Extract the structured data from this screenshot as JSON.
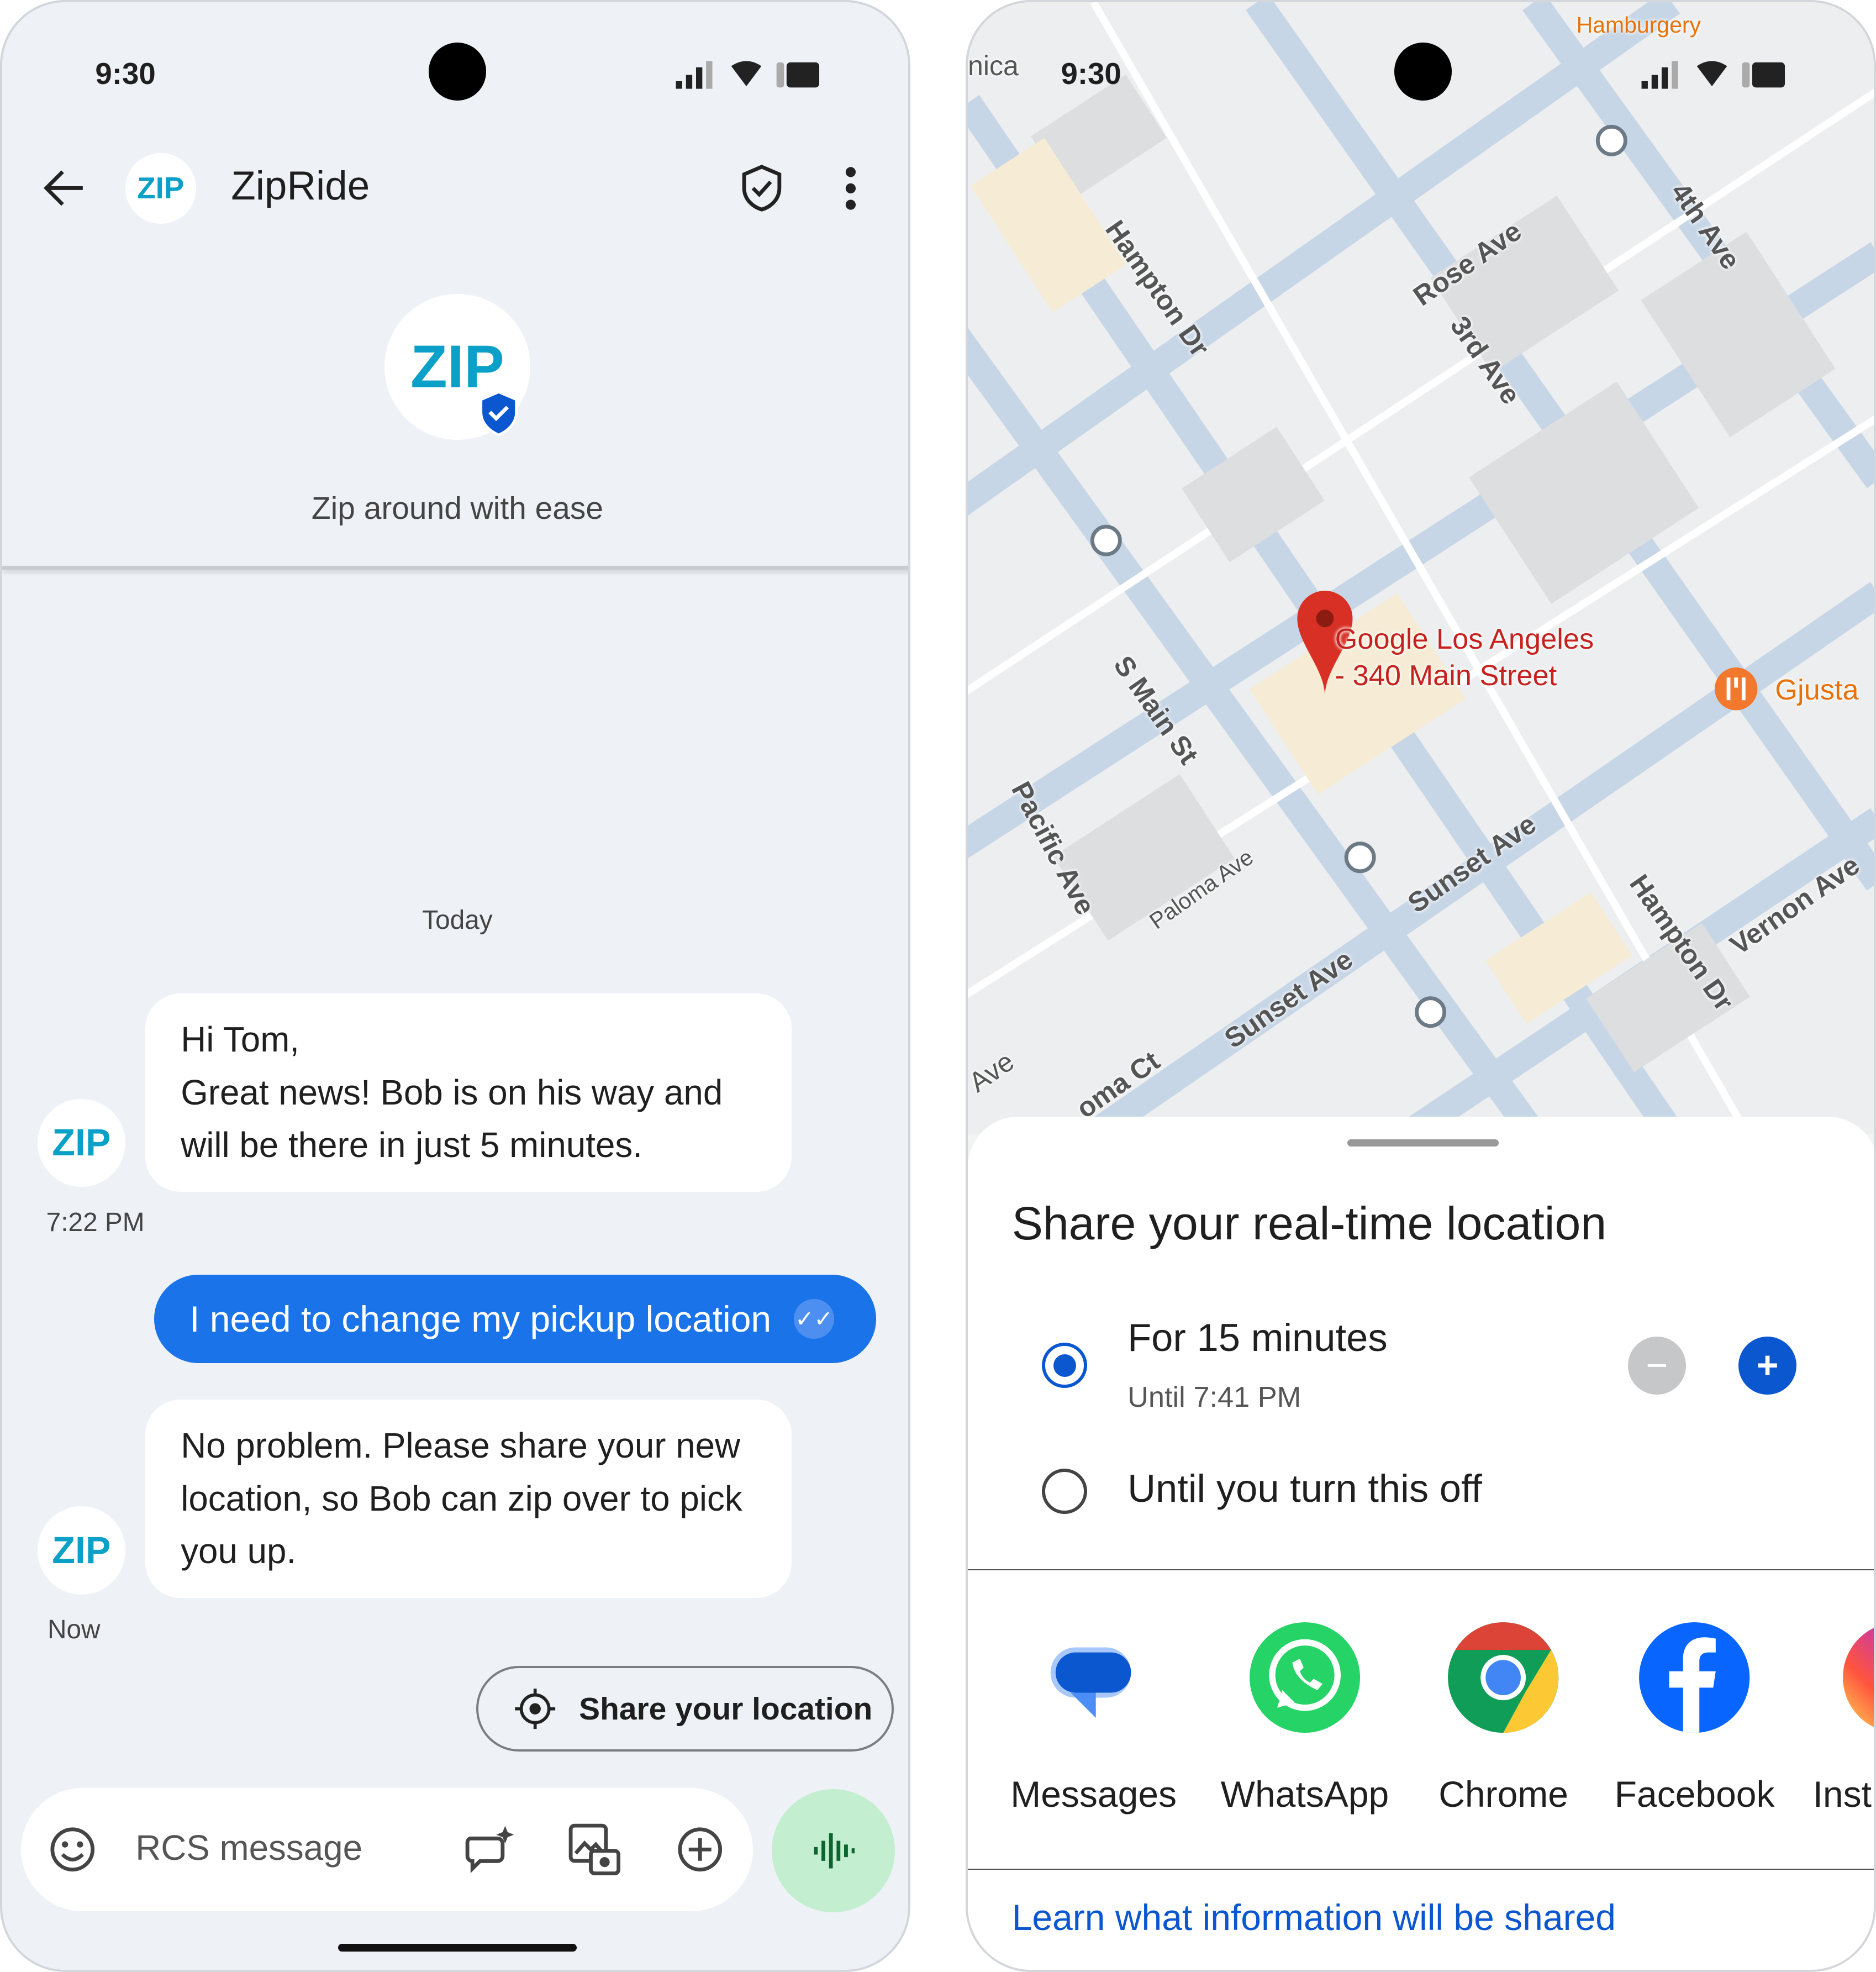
{
  "status": {
    "time": "9:30"
  },
  "chat": {
    "title": "ZipRide",
    "avatar_text": "ZIP",
    "tagline": "Zip around with ease",
    "date_divider": "Today",
    "messages": [
      {
        "from": "ZipRide",
        "text": "Hi Tom,\nGreat news! Bob is on his way and will be there in just 5 minutes.",
        "time": "7:22 PM"
      },
      {
        "from": "me",
        "text": "I need to change my pickup location",
        "status": "read"
      },
      {
        "from": "ZipRide",
        "text": "No problem. Please share your new location, so Bob can zip over to pick you up.",
        "time": "Now"
      }
    ],
    "suggestion": "Share your location",
    "composer_placeholder": "RCS message",
    "accent": "#1a73e8"
  },
  "map": {
    "place": "Google Los Angeles\n- 340 Main Street",
    "poi": "Gjusta",
    "poi_top": "Hamburgery",
    "edge_label": "nica",
    "streets": [
      "Hampton Dr",
      "Rose Ave",
      "3rd Ave",
      "4th Ave",
      "S Main St",
      "Pacific Ave",
      "Paloma Ave",
      "Sunset Ave",
      "Sunset Ave",
      "Hampton Dr",
      "Vernon Ave",
      "oma Ct",
      "Ave"
    ]
  },
  "sheet": {
    "title": "Share your real-time location",
    "options": [
      {
        "label": "For 15 minutes",
        "sub": "Until 7:41 PM",
        "selected": true
      },
      {
        "label": "Until you turn this off",
        "selected": false
      }
    ],
    "apps": [
      "Messages",
      "WhatsApp",
      "Chrome",
      "Facebook",
      "Inst"
    ],
    "learn_link": "Learn what information will be shared",
    "link_color": "#0b57d0"
  }
}
